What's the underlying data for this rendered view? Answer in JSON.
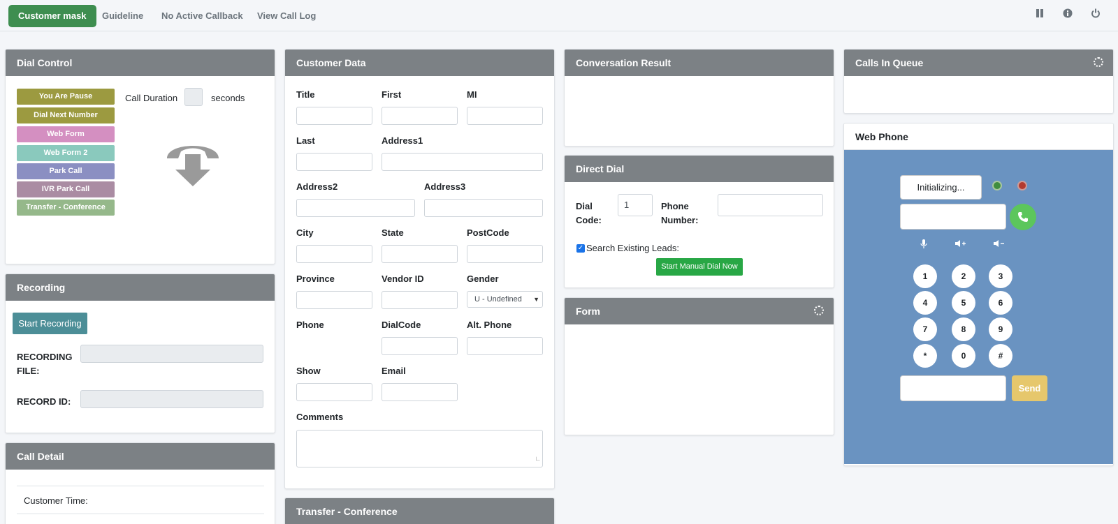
{
  "nav": {
    "tabs": [
      "Customer mask",
      "Guideline",
      "No Active Callback",
      "View Call Log"
    ],
    "icons": [
      "pause-icon",
      "info-icon",
      "power-icon"
    ]
  },
  "dial_control": {
    "title": "Dial Control",
    "buttons": [
      {
        "label": "You Are Pause",
        "color": "#9c9a40"
      },
      {
        "label": "Dial Next Number",
        "color": "#9c9a40"
      },
      {
        "label": "Web Form",
        "color": "#d48fc1"
      },
      {
        "label": "Web Form 2",
        "color": "#8ac9bd"
      },
      {
        "label": "Park Call",
        "color": "#8b8fc2"
      },
      {
        "label": "IVR Park Call",
        "color": "#aa8ca3"
      },
      {
        "label": "Transfer - Conference",
        "color": "#95b88a"
      }
    ],
    "call_duration_label": "Call Duration",
    "seconds_label": "seconds",
    "call_duration_value": ""
  },
  "recording": {
    "title": "Recording",
    "start_button": "Start Recording",
    "file_label": "RECORDING FILE:",
    "id_label": "RECORD ID:"
  },
  "call_detail": {
    "title": "Call Detail",
    "customer_time_label": "Customer Time:"
  },
  "customer_data": {
    "title": "Customer Data",
    "labels": {
      "title": "Title",
      "first": "First",
      "mi": "MI",
      "last": "Last",
      "address1": "Address1",
      "address2": "Address2",
      "address3": "Address3",
      "city": "City",
      "state": "State",
      "postcode": "PostCode",
      "province": "Province",
      "vendor_id": "Vendor ID",
      "gender": "Gender",
      "phone": "Phone",
      "dialcode": "DialCode",
      "alt_phone": "Alt. Phone",
      "show": "Show",
      "email": "Email",
      "comments": "Comments"
    },
    "gender_value": "U - Undefined"
  },
  "transfer_conference": {
    "title": "Transfer - Conference"
  },
  "conversation_result": {
    "title": "Conversation Result"
  },
  "direct_dial": {
    "title": "Direct Dial",
    "dial_code_label": "Dial Code:",
    "dial_code_value": "1",
    "phone_number_label": "Phone Number:",
    "search_existing_leads": "Search Existing Leads:",
    "search_checked": true,
    "start_button": "Start Manual Dial Now"
  },
  "form": {
    "title": "Form"
  },
  "calls_in_queue": {
    "title": "Calls In Queue"
  },
  "web_phone": {
    "title": "Web Phone",
    "status": "Initializing...",
    "keys": [
      "1",
      "2",
      "3",
      "4",
      "5",
      "6",
      "7",
      "8",
      "9",
      "*",
      "0",
      "#"
    ],
    "send_button": "Send",
    "status_leds": {
      "green": "#3f8d3f",
      "red": "#b33a2e"
    },
    "icons": [
      "microphone-icon",
      "volume-up-icon",
      "volume-down-icon"
    ]
  }
}
